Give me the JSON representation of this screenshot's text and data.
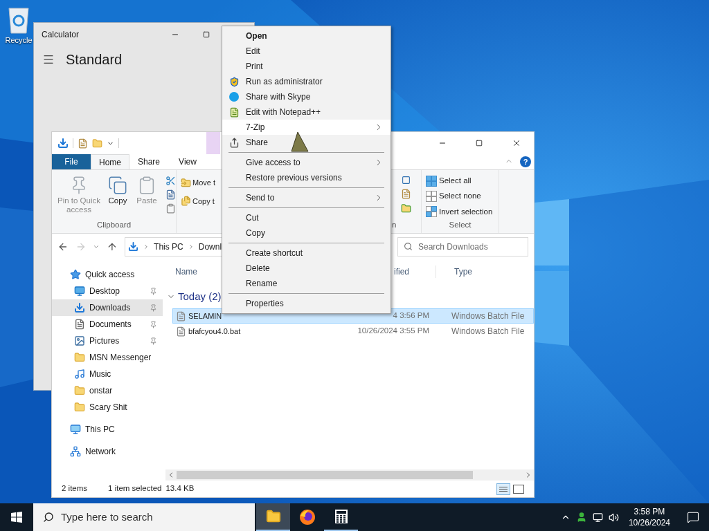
{
  "desktop": {
    "icons": [
      {
        "label": "Recycle"
      }
    ]
  },
  "calculator": {
    "title": "Calculator",
    "mode": "Standard"
  },
  "explorer": {
    "ribbon_tabs": [
      {
        "label": "File",
        "kind": "file",
        "selected": false
      },
      {
        "label": "Home",
        "kind": "tab",
        "selected": true
      },
      {
        "label": "Share",
        "kind": "tab",
        "selected": false
      },
      {
        "label": "View",
        "kind": "tab",
        "selected": false
      }
    ],
    "clipboard": {
      "group_label": "Clipboard",
      "buttons": [
        {
          "label": "Pin to Quick access",
          "kind": "pin",
          "disabled": true
        },
        {
          "label": "Copy",
          "kind": "copy",
          "disabled": false
        },
        {
          "label": "Paste",
          "kind": "paste",
          "disabled": true
        }
      ]
    },
    "organize": {
      "buttons": [
        {
          "label": "Move t",
          "kind": "move"
        },
        {
          "label": "Copy t",
          "kind": "copyto"
        }
      ]
    },
    "open_group": {
      "group_label": "n"
    },
    "help": "?",
    "select": {
      "group_label": "Select",
      "buttons": [
        {
          "label": "Select all",
          "kind": "all"
        },
        {
          "label": "Select none",
          "kind": "none"
        },
        {
          "label": "Invert selection",
          "kind": "invert"
        }
      ]
    },
    "address": {
      "segments": [
        "This PC",
        "Downl"
      ]
    },
    "search": {
      "placeholder": "Search Downloads"
    },
    "nav": [
      {
        "label": "Quick access",
        "kind": "star",
        "pinned": false,
        "selected": false,
        "children": [
          {
            "label": "Desktop",
            "kind": "desktop",
            "pinned": true,
            "selected": false
          },
          {
            "label": "Downloads",
            "kind": "download",
            "pinned": true,
            "selected": true
          },
          {
            "label": "Documents",
            "kind": "document",
            "pinned": true,
            "selected": false
          },
          {
            "label": "Pictures",
            "kind": "picture",
            "pinned": true,
            "selected": false
          },
          {
            "label": "MSN Messenger",
            "kind": "folder",
            "pinned": false,
            "selected": false
          },
          {
            "label": "Music",
            "kind": "music",
            "pinned": false,
            "selected": false
          },
          {
            "label": "onstar",
            "kind": "folder",
            "pinned": false,
            "selected": false
          },
          {
            "label": "Scary Shit",
            "kind": "folder",
            "pinned": false,
            "selected": false
          }
        ]
      },
      {
        "label": "This PC",
        "kind": "pc",
        "pinned": false,
        "selected": false
      },
      {
        "label": "Network",
        "kind": "network",
        "pinned": false,
        "selected": false
      }
    ],
    "columns": [
      {
        "label": "Name"
      },
      {
        "label": "ified"
      },
      {
        "label": "Type"
      }
    ],
    "groups": [
      {
        "label": "Today (2)",
        "files": [
          {
            "name": "SELAMIN",
            "modified": "4 3:56 PM",
            "type": "Windows Batch File",
            "selected": true
          },
          {
            "name": "bfafcyou4.0.bat",
            "modified": "10/26/2024 3:55 PM",
            "type": "Windows Batch File",
            "selected": false
          }
        ]
      }
    ],
    "status": {
      "count": "2 items",
      "selection": "1 item selected",
      "size": "13.4 KB"
    }
  },
  "context_menu": {
    "sections": [
      {
        "items": [
          {
            "label": "Open",
            "kind": "plain",
            "bold": true,
            "submenu": false,
            "highlighted": false
          },
          {
            "label": "Edit",
            "kind": "plain",
            "bold": false,
            "submenu": false,
            "highlighted": false
          },
          {
            "label": "Print",
            "kind": "plain",
            "bold": false,
            "submenu": false,
            "highlighted": false
          },
          {
            "label": "Run as administrator",
            "kind": "shield",
            "bold": false,
            "submenu": false,
            "highlighted": false
          },
          {
            "label": "Share with Skype",
            "kind": "skype",
            "bold": false,
            "submenu": false,
            "highlighted": false
          },
          {
            "label": "Edit with Notepad++",
            "kind": "notepad",
            "bold": false,
            "submenu": false,
            "highlighted": false
          },
          {
            "label": "7-Zip",
            "kind": "plain",
            "bold": false,
            "submenu": true,
            "highlighted": true
          },
          {
            "label": "Share",
            "kind": "share",
            "bold": false,
            "submenu": false,
            "highlighted": false
          }
        ]
      },
      {
        "items": [
          {
            "label": "Give access to",
            "kind": "plain",
            "bold": false,
            "submenu": true,
            "highlighted": false
          },
          {
            "label": "Restore previous versions",
            "kind": "plain",
            "bold": false,
            "submenu": false,
            "highlighted": false
          }
        ]
      },
      {
        "items": [
          {
            "label": "Send to",
            "kind": "plain",
            "bold": false,
            "submenu": true,
            "highlighted": false
          }
        ]
      },
      {
        "items": [
          {
            "label": "Cut",
            "kind": "plain",
            "bold": false,
            "submenu": false,
            "highlighted": false
          },
          {
            "label": "Copy",
            "kind": "plain",
            "bold": false,
            "submenu": false,
            "highlighted": false
          }
        ]
      },
      {
        "items": [
          {
            "label": "Create shortcut",
            "kind": "plain",
            "bold": false,
            "submenu": false,
            "highlighted": false
          },
          {
            "label": "Delete",
            "kind": "plain",
            "bold": false,
            "submenu": false,
            "highlighted": false
          },
          {
            "label": "Rename",
            "kind": "plain",
            "bold": false,
            "submenu": false,
            "highlighted": false
          }
        ]
      },
      {
        "items": [
          {
            "label": "Properties",
            "kind": "plain",
            "bold": false,
            "submenu": false,
            "highlighted": false
          }
        ]
      }
    ]
  },
  "taskbar": {
    "search": {
      "placeholder": "Type here to search"
    },
    "apps": [
      {
        "kind": "explorer",
        "open": true,
        "active": true
      },
      {
        "kind": "firefox",
        "open": false,
        "active": false
      },
      {
        "kind": "calculator",
        "open": true,
        "active": false
      }
    ],
    "time": "3:58 PM",
    "date": "10/26/2024"
  }
}
